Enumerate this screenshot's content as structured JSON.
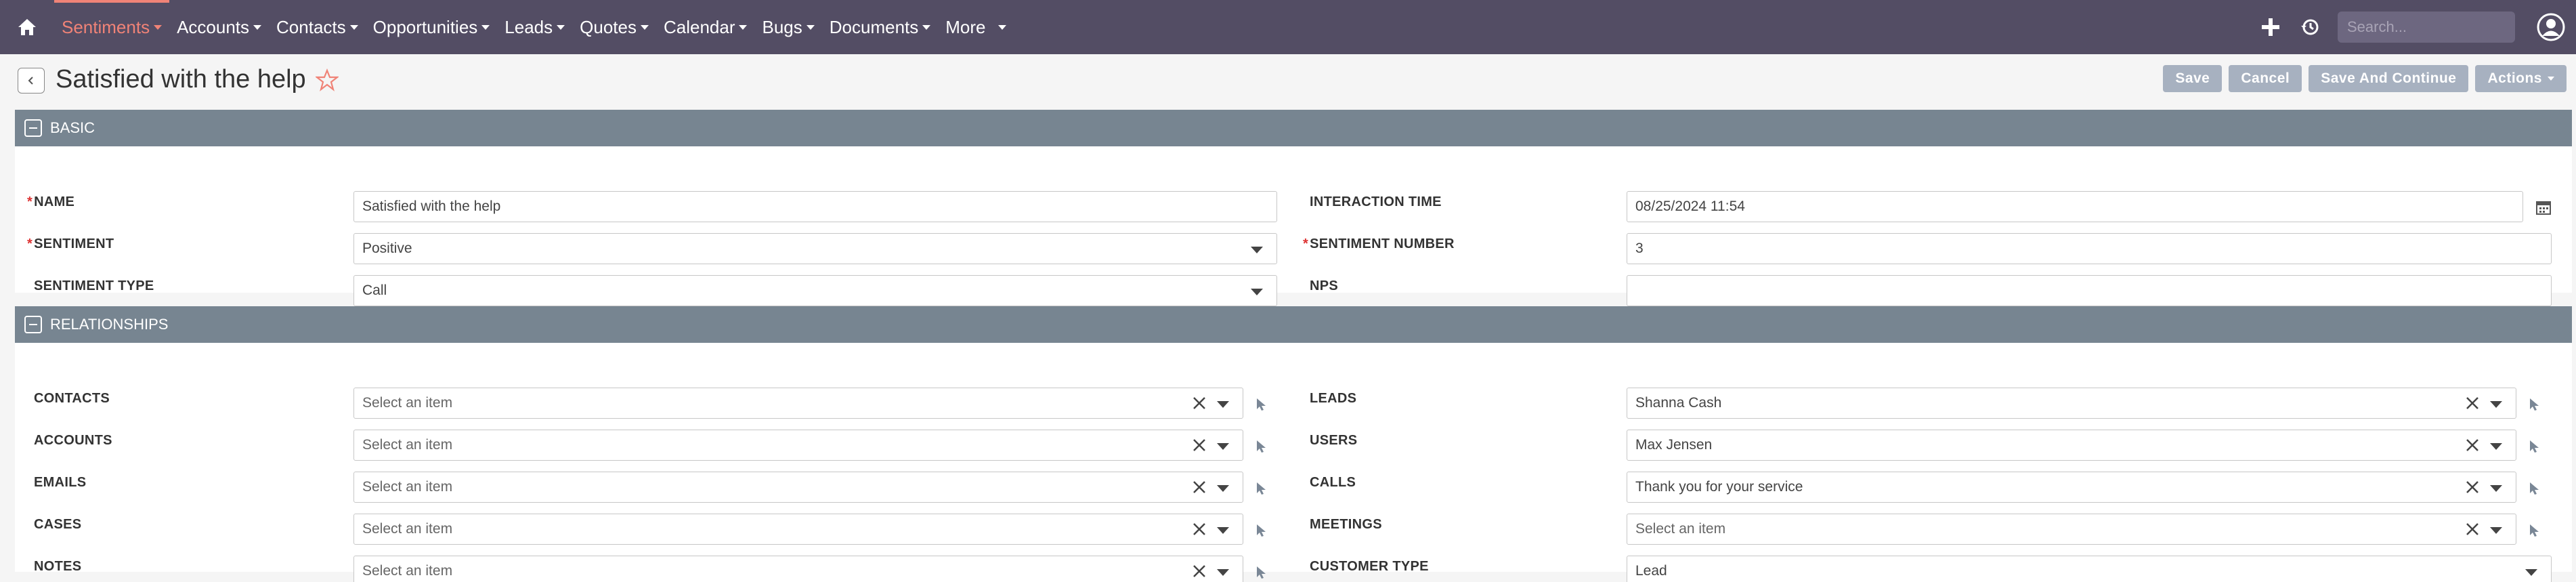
{
  "nav": {
    "items": [
      {
        "label": "Sentiments",
        "active": true
      },
      {
        "label": "Accounts"
      },
      {
        "label": "Contacts"
      },
      {
        "label": "Opportunities"
      },
      {
        "label": "Leads"
      },
      {
        "label": "Quotes"
      },
      {
        "label": "Calendar"
      },
      {
        "label": "Bugs"
      },
      {
        "label": "Documents"
      },
      {
        "label": "More"
      }
    ],
    "search_placeholder": "Search..."
  },
  "header": {
    "title": "Satisfied with the help",
    "buttons": {
      "save": "Save",
      "cancel": "Cancel",
      "save_continue": "Save And Continue",
      "actions": "Actions"
    }
  },
  "basic": {
    "title": "BASIC",
    "name_label": "NAME",
    "name_value": "Satisfied with the help",
    "interaction_time_label": "INTERACTION TIME",
    "interaction_time_value": "08/25/2024 11:54",
    "sentiment_label": "SENTIMENT",
    "sentiment_value": "Positive",
    "sentiment_number_label": "SENTIMENT NUMBER",
    "sentiment_number_value": "3",
    "sentiment_type_label": "SENTIMENT TYPE",
    "sentiment_type_value": "Call",
    "nps_label": "NPS",
    "nps_value": ""
  },
  "relationships": {
    "title": "RELATIONSHIPS",
    "left": [
      {
        "label": "CONTACTS",
        "value": "Select an item"
      },
      {
        "label": "ACCOUNTS",
        "value": "Select an item"
      },
      {
        "label": "EMAILS",
        "value": "Select an item"
      },
      {
        "label": "CASES",
        "value": "Select an item"
      },
      {
        "label": "NOTES",
        "value": "Select an item"
      }
    ],
    "right": [
      {
        "label": "LEADS",
        "value": "Shanna Cash"
      },
      {
        "label": "USERS",
        "value": "Max Jensen"
      },
      {
        "label": "CALLS",
        "value": "Thank you for your service"
      },
      {
        "label": "MEETINGS",
        "value": "Select an item"
      },
      {
        "label": "CUSTOMER TYPE",
        "value": "Lead"
      }
    ]
  },
  "colors": {
    "nav_bg": "#534d64",
    "accent": "#f08377",
    "panel_header": "#778591",
    "button": "#a7b1c0"
  }
}
